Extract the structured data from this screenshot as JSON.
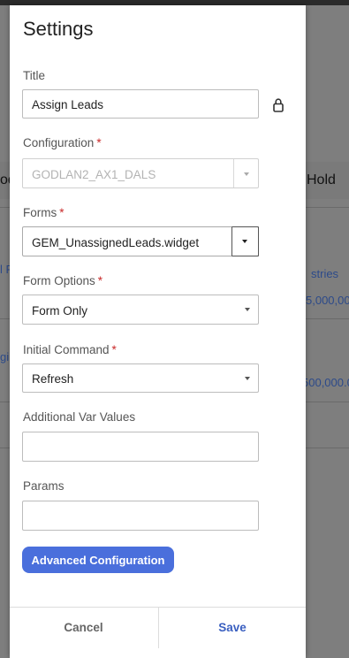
{
  "background": {
    "left_cut_1": "od",
    "right_header": "Hold",
    "left_cut_2": "l F",
    "left_cut_3": "gi",
    "right_text_1": "stries",
    "right_text_2": "5,000,000",
    "right_text_3": "500,000.0"
  },
  "modal": {
    "title": "Settings",
    "fields": {
      "title": {
        "label": "Title",
        "value": "Assign Leads"
      },
      "configuration": {
        "label": "Configuration",
        "required": "*",
        "value": "GODLAN2_AX1_DALS"
      },
      "forms": {
        "label": "Forms",
        "required": "*",
        "value": "GEM_UnassignedLeads.widget"
      },
      "form_options": {
        "label": "Form Options",
        "required": "*",
        "value": "Form Only"
      },
      "initial_command": {
        "label": "Initial Command",
        "required": "*",
        "value": "Refresh"
      },
      "additional_var_values": {
        "label": "Additional Var Values",
        "value": ""
      },
      "params": {
        "label": "Params",
        "value": ""
      }
    },
    "advanced_button": "Advanced Configuration",
    "footer": {
      "cancel": "Cancel",
      "save": "Save"
    }
  },
  "colors": {
    "accent": "#4a6fdc",
    "required": "#c92a2a",
    "save_text": "#3a5fc0"
  },
  "icons": [
    "lock-icon",
    "chevron-down-icon"
  ]
}
